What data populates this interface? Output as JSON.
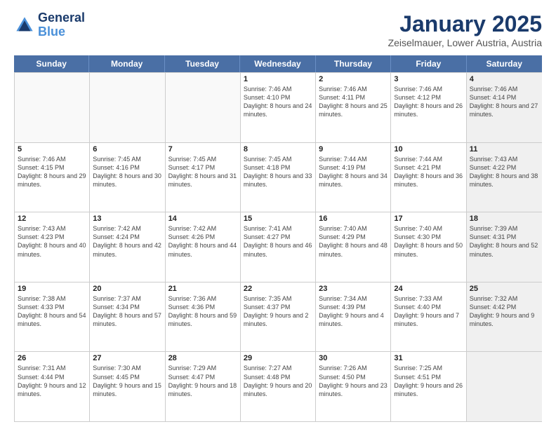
{
  "header": {
    "logo_line1": "General",
    "logo_line2": "Blue",
    "month": "January 2025",
    "location": "Zeiselmauer, Lower Austria, Austria"
  },
  "weekdays": [
    "Sunday",
    "Monday",
    "Tuesday",
    "Wednesday",
    "Thursday",
    "Friday",
    "Saturday"
  ],
  "weeks": [
    [
      {
        "day": "",
        "info": "",
        "empty": true
      },
      {
        "day": "",
        "info": "",
        "empty": true
      },
      {
        "day": "",
        "info": "",
        "empty": true
      },
      {
        "day": "1",
        "info": "Sunrise: 7:46 AM\nSunset: 4:10 PM\nDaylight: 8 hours\nand 24 minutes.",
        "empty": false
      },
      {
        "day": "2",
        "info": "Sunrise: 7:46 AM\nSunset: 4:11 PM\nDaylight: 8 hours\nand 25 minutes.",
        "empty": false
      },
      {
        "day": "3",
        "info": "Sunrise: 7:46 AM\nSunset: 4:12 PM\nDaylight: 8 hours\nand 26 minutes.",
        "empty": false
      },
      {
        "day": "4",
        "info": "Sunrise: 7:46 AM\nSunset: 4:14 PM\nDaylight: 8 hours\nand 27 minutes.",
        "empty": false,
        "shaded": true
      }
    ],
    [
      {
        "day": "5",
        "info": "Sunrise: 7:46 AM\nSunset: 4:15 PM\nDaylight: 8 hours\nand 29 minutes.",
        "empty": false
      },
      {
        "day": "6",
        "info": "Sunrise: 7:45 AM\nSunset: 4:16 PM\nDaylight: 8 hours\nand 30 minutes.",
        "empty": false
      },
      {
        "day": "7",
        "info": "Sunrise: 7:45 AM\nSunset: 4:17 PM\nDaylight: 8 hours\nand 31 minutes.",
        "empty": false
      },
      {
        "day": "8",
        "info": "Sunrise: 7:45 AM\nSunset: 4:18 PM\nDaylight: 8 hours\nand 33 minutes.",
        "empty": false
      },
      {
        "day": "9",
        "info": "Sunrise: 7:44 AM\nSunset: 4:19 PM\nDaylight: 8 hours\nand 34 minutes.",
        "empty": false
      },
      {
        "day": "10",
        "info": "Sunrise: 7:44 AM\nSunset: 4:21 PM\nDaylight: 8 hours\nand 36 minutes.",
        "empty": false
      },
      {
        "day": "11",
        "info": "Sunrise: 7:43 AM\nSunset: 4:22 PM\nDaylight: 8 hours\nand 38 minutes.",
        "empty": false,
        "shaded": true
      }
    ],
    [
      {
        "day": "12",
        "info": "Sunrise: 7:43 AM\nSunset: 4:23 PM\nDaylight: 8 hours\nand 40 minutes.",
        "empty": false
      },
      {
        "day": "13",
        "info": "Sunrise: 7:42 AM\nSunset: 4:24 PM\nDaylight: 8 hours\nand 42 minutes.",
        "empty": false
      },
      {
        "day": "14",
        "info": "Sunrise: 7:42 AM\nSunset: 4:26 PM\nDaylight: 8 hours\nand 44 minutes.",
        "empty": false
      },
      {
        "day": "15",
        "info": "Sunrise: 7:41 AM\nSunset: 4:27 PM\nDaylight: 8 hours\nand 46 minutes.",
        "empty": false
      },
      {
        "day": "16",
        "info": "Sunrise: 7:40 AM\nSunset: 4:29 PM\nDaylight: 8 hours\nand 48 minutes.",
        "empty": false
      },
      {
        "day": "17",
        "info": "Sunrise: 7:40 AM\nSunset: 4:30 PM\nDaylight: 8 hours\nand 50 minutes.",
        "empty": false
      },
      {
        "day": "18",
        "info": "Sunrise: 7:39 AM\nSunset: 4:31 PM\nDaylight: 8 hours\nand 52 minutes.",
        "empty": false,
        "shaded": true
      }
    ],
    [
      {
        "day": "19",
        "info": "Sunrise: 7:38 AM\nSunset: 4:33 PM\nDaylight: 8 hours\nand 54 minutes.",
        "empty": false
      },
      {
        "day": "20",
        "info": "Sunrise: 7:37 AM\nSunset: 4:34 PM\nDaylight: 8 hours\nand 57 minutes.",
        "empty": false
      },
      {
        "day": "21",
        "info": "Sunrise: 7:36 AM\nSunset: 4:36 PM\nDaylight: 8 hours\nand 59 minutes.",
        "empty": false
      },
      {
        "day": "22",
        "info": "Sunrise: 7:35 AM\nSunset: 4:37 PM\nDaylight: 9 hours\nand 2 minutes.",
        "empty": false
      },
      {
        "day": "23",
        "info": "Sunrise: 7:34 AM\nSunset: 4:39 PM\nDaylight: 9 hours\nand 4 minutes.",
        "empty": false
      },
      {
        "day": "24",
        "info": "Sunrise: 7:33 AM\nSunset: 4:40 PM\nDaylight: 9 hours\nand 7 minutes.",
        "empty": false
      },
      {
        "day": "25",
        "info": "Sunrise: 7:32 AM\nSunset: 4:42 PM\nDaylight: 9 hours\nand 9 minutes.",
        "empty": false,
        "shaded": true
      }
    ],
    [
      {
        "day": "26",
        "info": "Sunrise: 7:31 AM\nSunset: 4:44 PM\nDaylight: 9 hours\nand 12 minutes.",
        "empty": false
      },
      {
        "day": "27",
        "info": "Sunrise: 7:30 AM\nSunset: 4:45 PM\nDaylight: 9 hours\nand 15 minutes.",
        "empty": false
      },
      {
        "day": "28",
        "info": "Sunrise: 7:29 AM\nSunset: 4:47 PM\nDaylight: 9 hours\nand 18 minutes.",
        "empty": false
      },
      {
        "day": "29",
        "info": "Sunrise: 7:27 AM\nSunset: 4:48 PM\nDaylight: 9 hours\nand 20 minutes.",
        "empty": false
      },
      {
        "day": "30",
        "info": "Sunrise: 7:26 AM\nSunset: 4:50 PM\nDaylight: 9 hours\nand 23 minutes.",
        "empty": false
      },
      {
        "day": "31",
        "info": "Sunrise: 7:25 AM\nSunset: 4:51 PM\nDaylight: 9 hours\nand 26 minutes.",
        "empty": false
      },
      {
        "day": "",
        "info": "",
        "empty": true,
        "shaded": true
      }
    ]
  ]
}
